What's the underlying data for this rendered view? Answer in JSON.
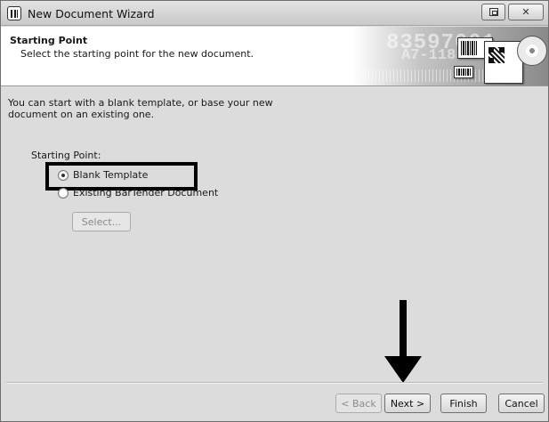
{
  "window": {
    "title": "New Document Wizard"
  },
  "header": {
    "title": "Starting Point",
    "subtitle": "Select the starting point for the new document.",
    "watermark_number": "83597001",
    "watermark_code": "A7-118"
  },
  "content": {
    "intro": "You can start with a blank template, or base your new document on an existing one.",
    "starting_point_label": "Starting Point:",
    "options": [
      {
        "label": "Blank Template",
        "selected": true
      },
      {
        "label": "Existing BarTender Document",
        "selected": false
      }
    ],
    "select_button": "Select..."
  },
  "footer": {
    "back": "< Back",
    "next": "Next >",
    "finish": "Finish",
    "cancel": "Cancel"
  }
}
